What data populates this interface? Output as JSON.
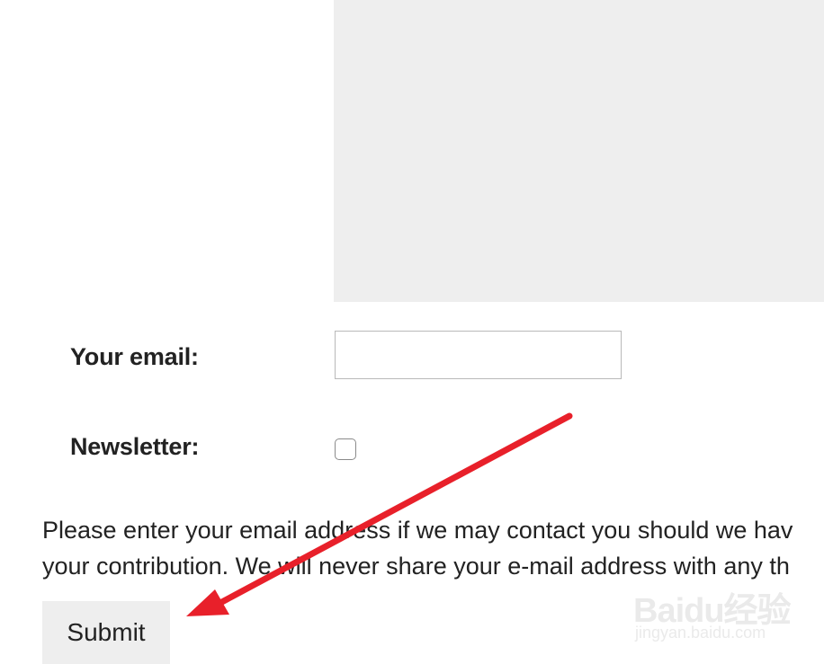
{
  "form": {
    "message_value": "",
    "email_label": "Your email:",
    "email_value": "",
    "newsletter_label": "Newsletter:",
    "newsletter_checked": false,
    "notice_line_1": "Please enter your email address if we may contact you should we hav",
    "notice_line_2": "your contribution. We will never share your e-mail address with any th",
    "submit_label": "Submit"
  },
  "watermark": {
    "brand": "Baidu经验",
    "url": "jingyan.baidu.com"
  },
  "colors": {
    "arrow": "#e8202a",
    "field_background": "#eeeeee",
    "text": "#222222"
  }
}
